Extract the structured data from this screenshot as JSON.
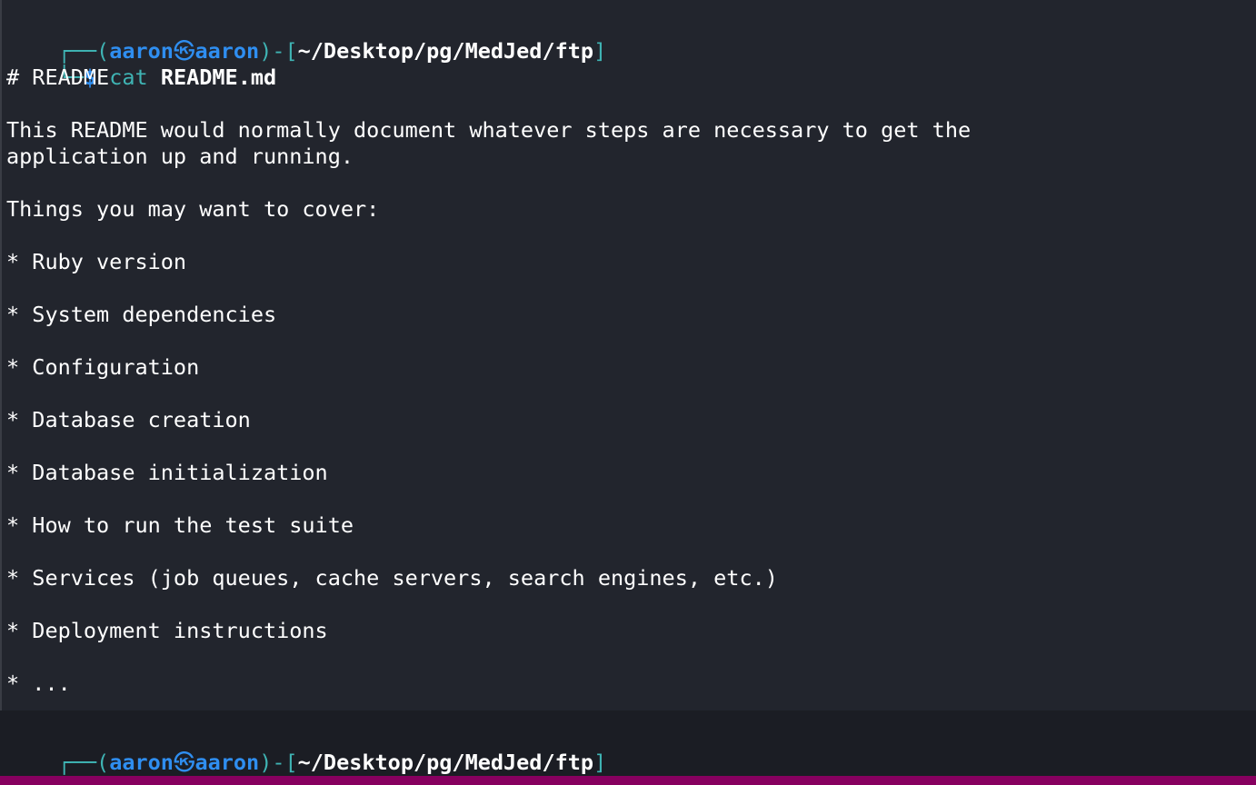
{
  "prompt": {
    "tree_top": "┌──(",
    "user": "aaron",
    "at_icon": "㉿",
    "host": "aaron",
    "mid": ")-[",
    "path": "~/Desktop/pg/MedJed/ftp",
    "end": "]",
    "tree_bottom": "└─",
    "dollar": "$"
  },
  "command": {
    "name": "cat",
    "arg": "README.md"
  },
  "output_lines": [
    "# README",
    "",
    "This README would normally document whatever steps are necessary to get the",
    "application up and running.",
    "",
    "Things you may want to cover:",
    "",
    "* Ruby version",
    "",
    "* System dependencies",
    "",
    "* Configuration",
    "",
    "* Database creation",
    "",
    "* Database initialization",
    "",
    "* How to run the test suite",
    "",
    "* Services (job queues, cache servers, search engines, etc.)",
    "",
    "* Deployment instructions",
    "",
    "* ..."
  ],
  "colors": {
    "background": "#22252d",
    "bottom_band": "#1b1d24",
    "status_bar": "#87005f",
    "accent_blue": "#2f8ef0",
    "accent_teal": "#3fb4b4"
  }
}
